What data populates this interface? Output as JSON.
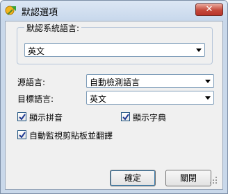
{
  "window": {
    "title": "默認選項",
    "close_symbol": "✕"
  },
  "group": {
    "legend": "默認系統語言:",
    "combo_value": "英文"
  },
  "source": {
    "label": "源語言:",
    "value": "自動檢測語言"
  },
  "target": {
    "label": "目標語言:",
    "value": "英文"
  },
  "options": {
    "pinyin": {
      "label": "顯示拼音",
      "checked": true
    },
    "dictionary": {
      "label": "顯示字典",
      "checked": true
    },
    "clipboard": {
      "label": "自動監視剪貼板並翻譯",
      "checked": true
    }
  },
  "buttons": {
    "ok": "確定",
    "close": "關閉"
  },
  "icons": {
    "app": "translate-app-icon",
    "close": "close-icon",
    "dropdown": "chevron-down-icon",
    "check": "checkmark-icon",
    "grip": "resize-grip-icon"
  }
}
